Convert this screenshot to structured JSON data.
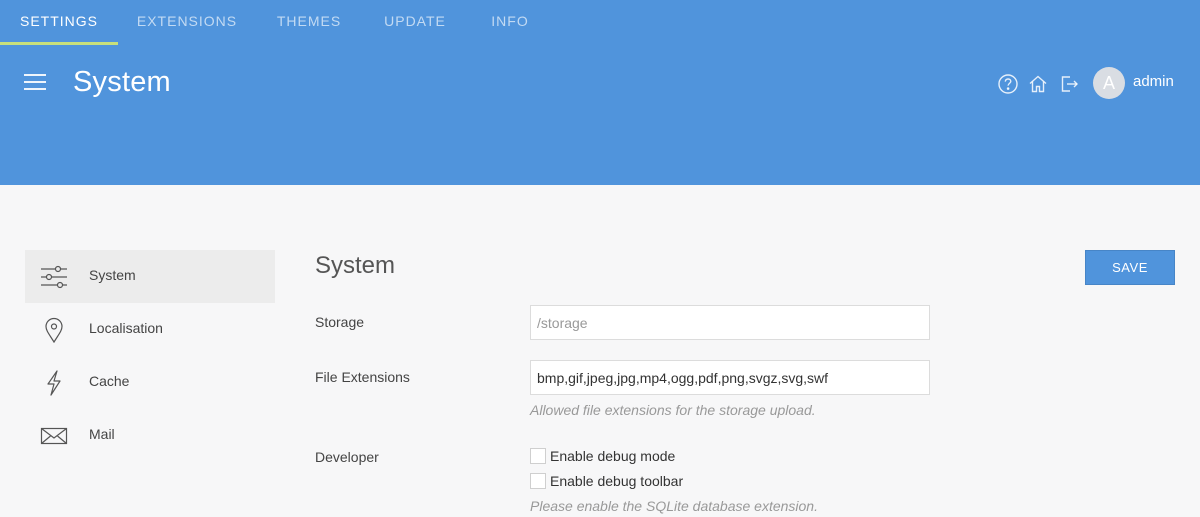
{
  "header": {
    "title": "System",
    "menu_icon": "hamburger-menu-icon",
    "icons": [
      "help-icon",
      "home-icon",
      "logout-icon"
    ],
    "avatar_initial": "A",
    "username": "admin",
    "accent_color": "#5094dc"
  },
  "tabs": [
    {
      "label": "SETTINGS",
      "active": true
    },
    {
      "label": "EXTENSIONS",
      "active": false
    },
    {
      "label": "THEMES",
      "active": false
    },
    {
      "label": "UPDATE",
      "active": false
    },
    {
      "label": "INFO",
      "active": false
    }
  ],
  "sidebar": {
    "items": [
      {
        "label": "System",
        "icon": "sliders-icon",
        "active": true
      },
      {
        "label": "Localisation",
        "icon": "map-pin-icon",
        "active": false
      },
      {
        "label": "Cache",
        "icon": "lightning-icon",
        "active": false
      },
      {
        "label": "Mail",
        "icon": "mail-icon",
        "active": false
      }
    ]
  },
  "main": {
    "title": "System",
    "save_label": "SAVE",
    "storage": {
      "label": "Storage",
      "value": "",
      "placeholder": "/storage"
    },
    "file_extensions": {
      "label": "File Extensions",
      "value": "bmp,gif,jpeg,jpg,mp4,ogg,pdf,png,svgz,svg,swf",
      "help": "Allowed file extensions for the storage upload."
    },
    "developer": {
      "label": "Developer",
      "options": [
        {
          "label": "Enable debug mode",
          "checked": false
        },
        {
          "label": "Enable debug toolbar",
          "checked": false
        }
      ],
      "help": "Please enable the SQLite database extension."
    }
  }
}
